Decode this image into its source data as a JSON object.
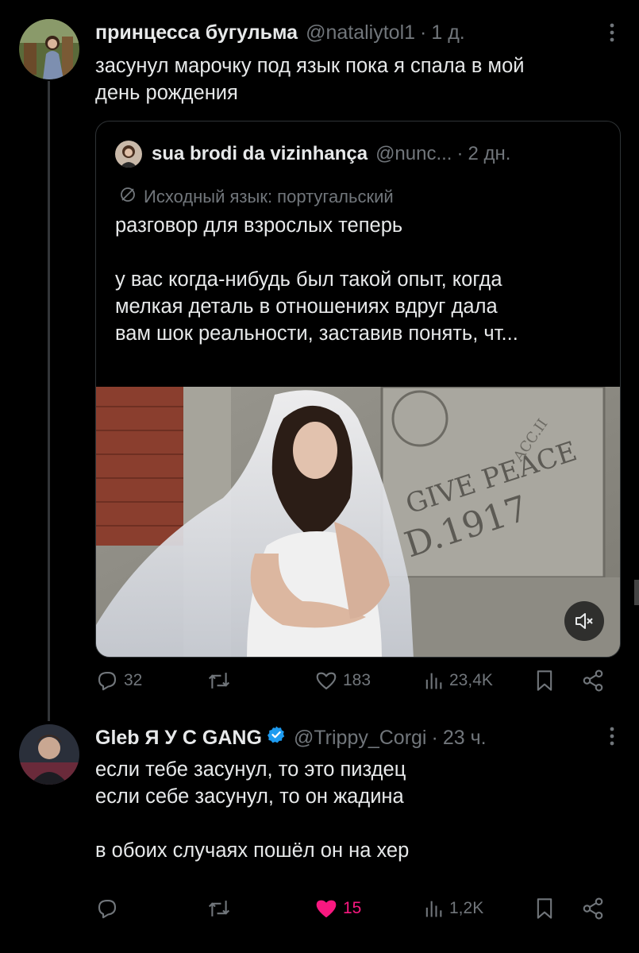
{
  "tweets": [
    {
      "name": "принцесса бугульма",
      "handle": "@nataliytol1",
      "time": "1 д.",
      "text": "засунул марочку под язык пока я спала в мой\nдень рождения",
      "quote": {
        "name": "sua brodi da vizinhança",
        "handle": "@nunc...",
        "time": "2 дн.",
        "translation_note": "Исходный язык: португальский",
        "text": "разговор для взрослых теперь\n\nу вас когда-нибудь был такой опыт, когда\nмелкая деталь в отношениях вдруг дала\nвам шок реальности, заставив понять, чт...",
        "media_text_line1": "GIVE PEACE",
        "media_text_line2": "D.1917",
        "media_text_acc": "ACC.II"
      },
      "actions": {
        "replies": "32",
        "reposts": "",
        "likes": "183",
        "views": "23,4K"
      }
    },
    {
      "name": "Gleb Я У С GANG",
      "handle": "@Trippy_Corgi",
      "time": "23 ч.",
      "text": "если тебе засунул, то это пиздец\nесли себе засунул, то он жадина\n\nв обоих случаях пошёл он на хер",
      "actions": {
        "replies": "",
        "reposts": "",
        "likes": "15",
        "views": "1,2K"
      }
    }
  ],
  "colors": {
    "background": "#000000",
    "text": "#e7e9ea",
    "muted": "#71767b",
    "like_active": "#f91880",
    "verified": "#1d9bf0",
    "border": "#2f3336"
  },
  "icons": [
    "more-icon",
    "globe-icon",
    "mute-icon",
    "reply-icon",
    "repost-icon",
    "like-icon",
    "views-icon",
    "bookmark-icon",
    "share-icon",
    "verified-icon"
  ]
}
